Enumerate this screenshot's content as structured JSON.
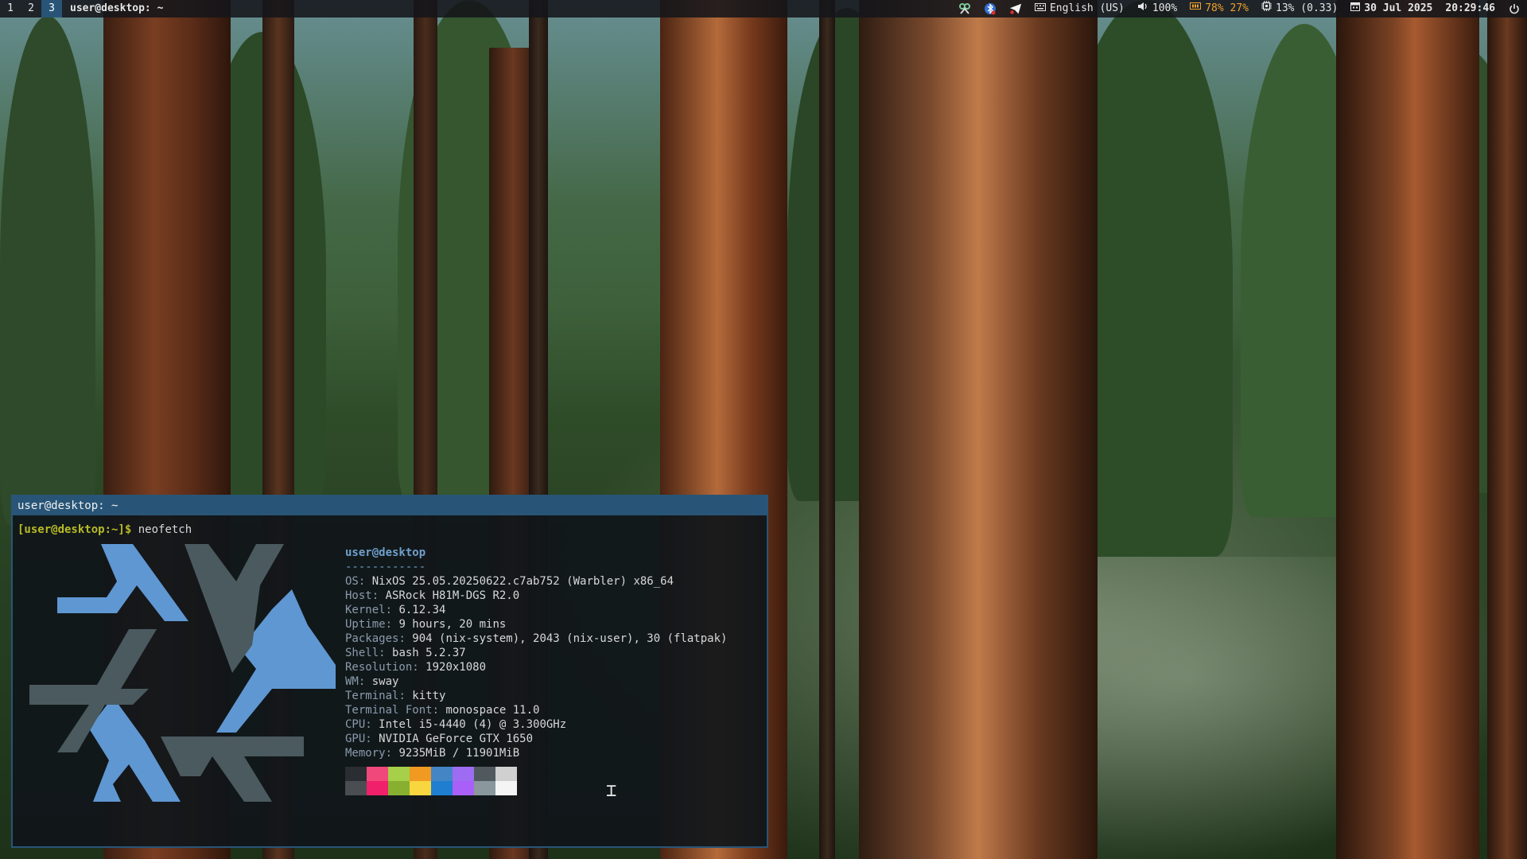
{
  "topbar": {
    "workspaces": [
      {
        "label": "1",
        "active": false
      },
      {
        "label": "2",
        "active": false
      },
      {
        "label": "3",
        "active": true
      }
    ],
    "window_title": "user@desktop: ~",
    "tray_icons": [
      "network-icon",
      "bluetooth-icon",
      "telegram-icon"
    ],
    "keyboard_layout": "English (US)",
    "volume": "100%",
    "memory": "78% 27%",
    "cpu": "13% (0.33)",
    "date": "30 Jul 2025",
    "time": "20:29:46"
  },
  "terminal": {
    "title": "user@desktop: ~",
    "prompt": "[user@desktop:~]$",
    "command": "neofetch",
    "user_host": "user@desktop",
    "separator": "------------",
    "info": [
      {
        "key": "OS",
        "value": "NixOS 25.05.20250622.c7ab752 (Warbler) x86_64"
      },
      {
        "key": "Host",
        "value": "ASRock H81M-DGS R2.0"
      },
      {
        "key": "Kernel",
        "value": "6.12.34"
      },
      {
        "key": "Uptime",
        "value": "9 hours, 20 mins"
      },
      {
        "key": "Packages",
        "value": "904 (nix-system), 2043 (nix-user), 30 (flatpak)"
      },
      {
        "key": "Shell",
        "value": "bash 5.2.37"
      },
      {
        "key": "Resolution",
        "value": "1920x1080"
      },
      {
        "key": "WM",
        "value": "sway"
      },
      {
        "key": "Terminal",
        "value": "kitty"
      },
      {
        "key": "Terminal Font",
        "value": "monospace 11.0"
      },
      {
        "key": "CPU",
        "value": "Intel i5-4440 (4) @ 3.300GHz"
      },
      {
        "key": "GPU",
        "value": "NVIDIA GeForce GTX 1650"
      },
      {
        "key": "Memory",
        "value": "9235MiB / 11901MiB"
      }
    ],
    "palette_top": [
      "#2a2d32",
      "#f0487a",
      "#a6d04a",
      "#f09a22",
      "#4485c6",
      "#9d6cf2",
      "#50595e",
      "#d0d0d0"
    ],
    "palette_bottom": [
      "#4a4d52",
      "#f0206a",
      "#88b030",
      "#f8d640",
      "#1f7ed0",
      "#a860f8",
      "#8a989e",
      "#f4f4f4"
    ],
    "logo_colors": {
      "primary": "#5f97d2",
      "secondary": "#4a5a5e"
    }
  }
}
